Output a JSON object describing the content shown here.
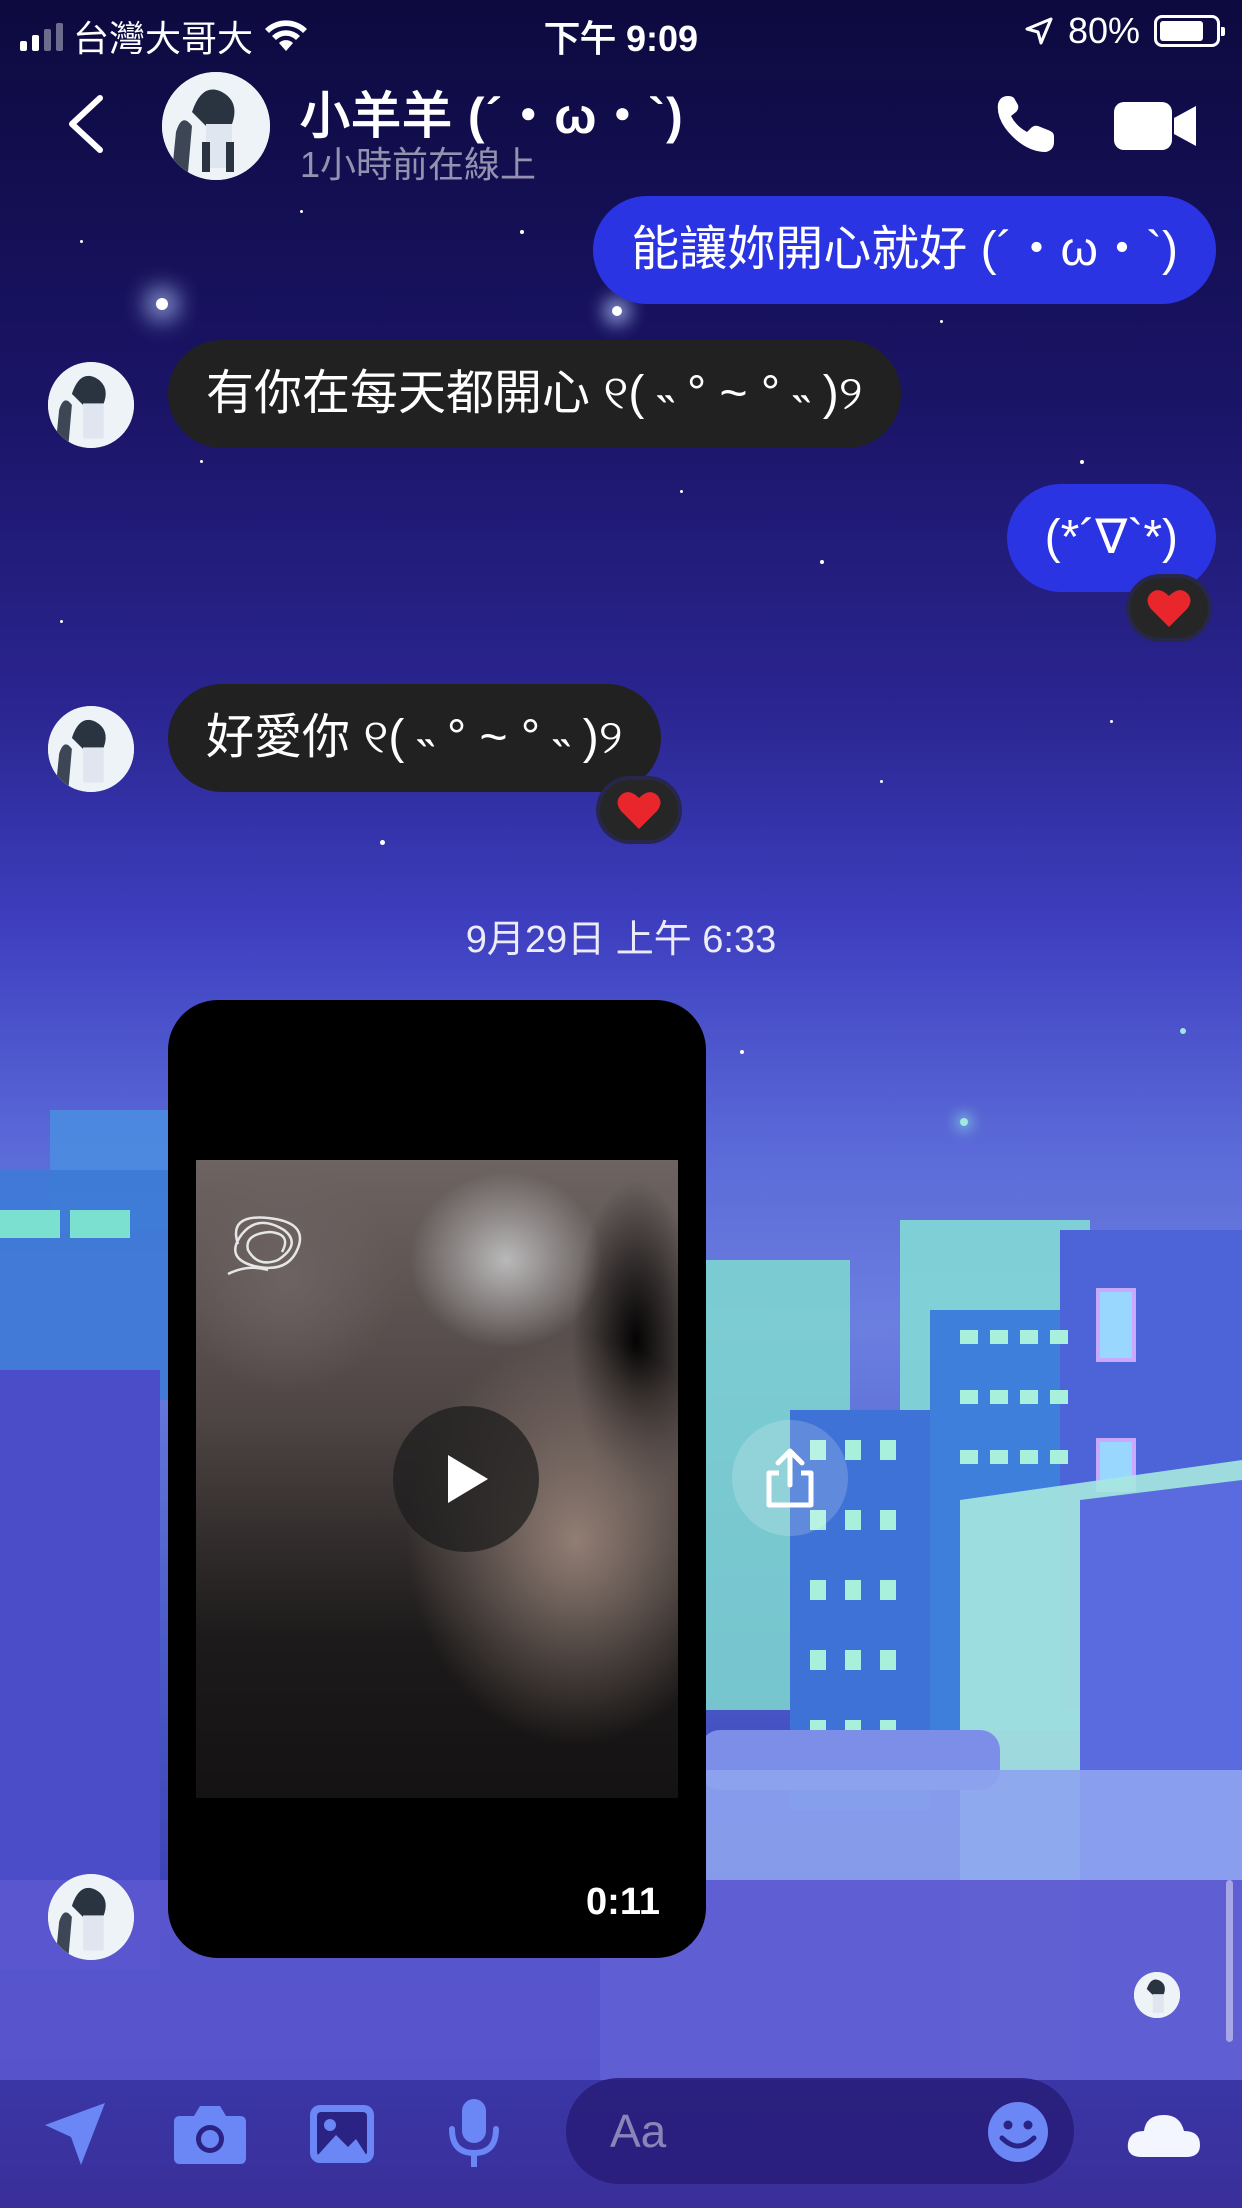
{
  "status_bar": {
    "carrier": "台灣大哥大",
    "time": "下午 9:09",
    "battery_percent": "80%"
  },
  "header": {
    "name": "小羊羊 (´・ω・`)",
    "subtitle": "1小時前在線上"
  },
  "messages": [
    {
      "from": "me",
      "text": "能讓妳開心就好 (´・ω・`)"
    },
    {
      "from": "them",
      "text": "有你在每天都開心 ୧( ˵ ° ~ ° ˵ )୨"
    },
    {
      "from": "me",
      "text": "(*´∇`*)",
      "reaction": "heart"
    },
    {
      "from": "them",
      "text": "好愛你 ୧( ˵ ° ~ ° ˵ )୨",
      "reaction": "heart"
    }
  ],
  "timestamp": "9月29日 上午 6:33",
  "video": {
    "duration": "0:11"
  },
  "composer": {
    "placeholder": "Aa"
  },
  "colors": {
    "my_bubble": "#2b34e2",
    "their_bubble": "#212121",
    "reaction_heart": "#e8262b",
    "composer_icons": "#6b86f5"
  }
}
